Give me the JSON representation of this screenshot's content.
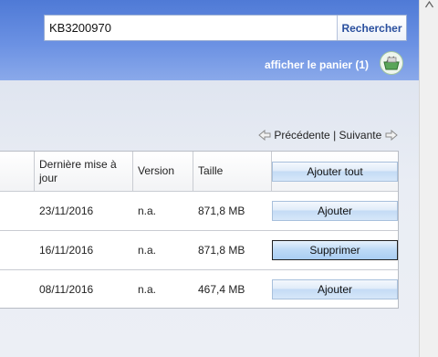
{
  "search": {
    "value": "KB3200970",
    "button_label": "Rechercher"
  },
  "cart": {
    "label": "afficher le panier (1)",
    "icon": "basket-icon"
  },
  "pager": {
    "prev_label": "Précédente",
    "separator": "|",
    "next_label": "Suivante"
  },
  "table": {
    "columns": {
      "date": "Dernière mise à jour",
      "version": "Version",
      "size": "Taille",
      "add_all": "Ajouter tout"
    },
    "rows": [
      {
        "date": "23/11/2016",
        "version": "n.a.",
        "size": "871,8 MB",
        "action": "Ajouter"
      },
      {
        "date": "16/11/2016",
        "version": "n.a.",
        "size": "871,8 MB",
        "action": "Supprimer"
      },
      {
        "date": "08/11/2016",
        "version": "n.a.",
        "size": "467,4 MB",
        "action": "Ajouter"
      }
    ]
  },
  "colors": {
    "header_blue": "#5b84dc",
    "link_blue": "#2a4f9e"
  }
}
